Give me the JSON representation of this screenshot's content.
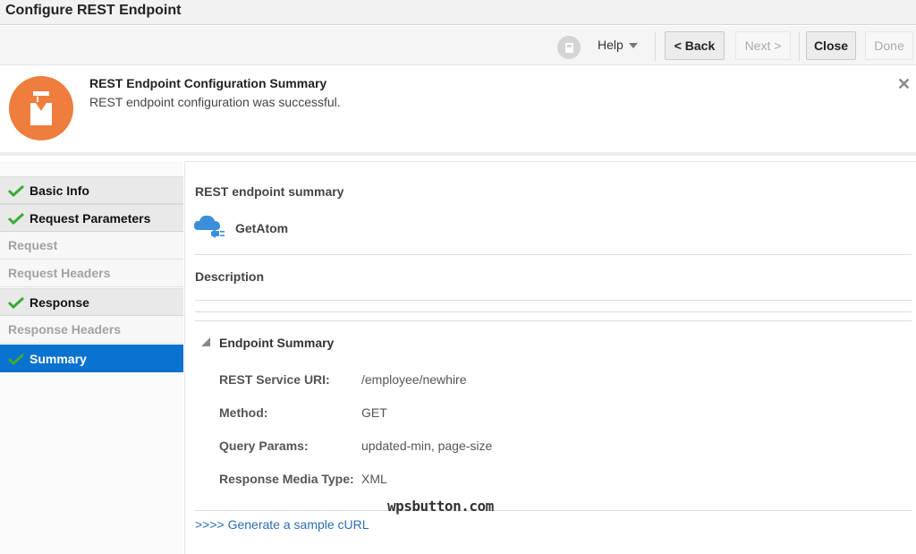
{
  "window": {
    "title": "Configure REST Endpoint"
  },
  "toolbar": {
    "help_label": "Help",
    "back_label": "< Back",
    "next_label": "Next >",
    "close_label": "Close",
    "done_label": "Done"
  },
  "banner": {
    "title": "REST Endpoint Configuration Summary",
    "message": "REST endpoint configuration was successful.",
    "close_glyph": "✕"
  },
  "sidebar": {
    "items": [
      {
        "label": "Basic Info",
        "state": "complete"
      },
      {
        "label": "Request Parameters",
        "state": "complete"
      },
      {
        "label": "Request",
        "state": "disabled"
      },
      {
        "label": "Request Headers",
        "state": "disabled"
      },
      {
        "label": "Response",
        "state": "complete"
      },
      {
        "label": "Response Headers",
        "state": "disabled"
      },
      {
        "label": "Summary",
        "state": "active"
      }
    ]
  },
  "main": {
    "section_title": "REST endpoint summary",
    "endpoint_name": "GetAtom",
    "description_label": "Description",
    "endpoint_summary": {
      "title": "Endpoint Summary",
      "fields": [
        {
          "label": "REST Service URI:",
          "value": "/employee/newhire"
        },
        {
          "label": "Method:",
          "value": "GET"
        },
        {
          "label": "Query Params:",
          "value": "updated-min, page-size"
        },
        {
          "label": "Response Media Type:",
          "value": "XML"
        }
      ]
    },
    "curl_link": ">>>> Generate a sample cURL",
    "watermark": "wpsbutton.com"
  },
  "colors": {
    "accent": "#0a72cf",
    "banner_icon": "#ef7e3e",
    "check": "#3aaa35",
    "link": "#2a6fb1",
    "cloud": "#3b8fd9"
  }
}
